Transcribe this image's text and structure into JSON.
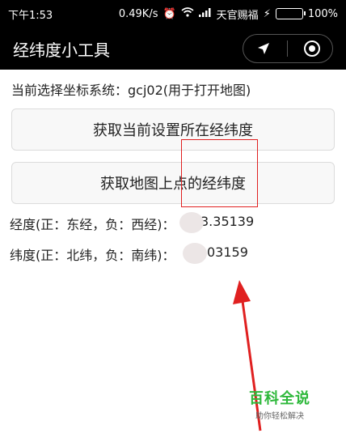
{
  "status_bar": {
    "time": "下午1:53",
    "speed": "0.49K/s",
    "carrier": "天官赐福",
    "battery": "100%"
  },
  "header": {
    "title": "经纬度小工具"
  },
  "main": {
    "coord_system_label": "当前选择坐标系统：gcj02(用于打开地图)",
    "get_current_button": "获取当前设置所在经纬度",
    "get_map_point_button": "获取地图上点的经纬度",
    "longitude_label": "经度(正：东经，负：西经)：",
    "longitude_value": "3.35139",
    "latitude_label": "纬度(正：北纬，负：南纬)：",
    "latitude_value": "03159"
  },
  "watermark": {
    "brand": "百科全说",
    "slogan": "助你轻松解决"
  },
  "colors": {
    "annotation": "#e02020",
    "watermark": "#2eb83b"
  }
}
